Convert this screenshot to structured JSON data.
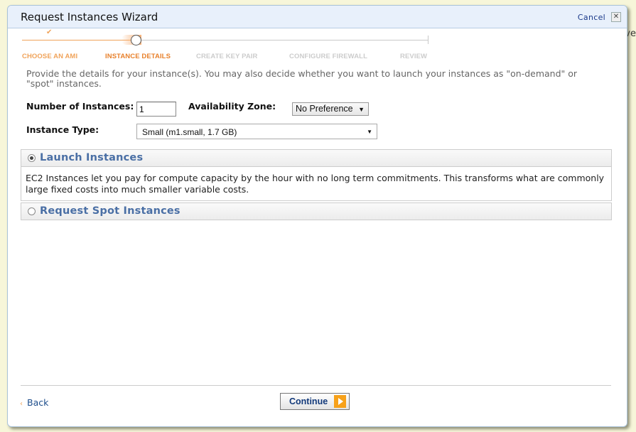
{
  "background_peek_text": "rve",
  "dialog": {
    "title": "Request Instances Wizard",
    "cancel_label": "Cancel",
    "close_glyph": "✕"
  },
  "wizard_steps": [
    {
      "label": "CHOOSE AN AMI",
      "state": "done"
    },
    {
      "label": "INSTANCE DETAILS",
      "state": "active"
    },
    {
      "label": "CREATE KEY PAIR",
      "state": "todo"
    },
    {
      "label": "CONFIGURE FIREWALL",
      "state": "todo"
    },
    {
      "label": "REVIEW",
      "state": "todo"
    }
  ],
  "check_glyph": "✔",
  "intro_text": "Provide the details for your instance(s). You may also decide whether you want to launch your instances as \"on-demand\" or \"spot\" instances.",
  "form": {
    "num_instances_label": "Number of Instances:",
    "num_instances_value": "1",
    "availability_zone_label": "Availability Zone:",
    "availability_zone_value": "No Preference",
    "availability_zone_arrow": "▼",
    "instance_type_label": "Instance Type:",
    "instance_type_value": "Small (m1.small, 1.7 GB)",
    "instance_type_arrow": "▼"
  },
  "options": {
    "launch": {
      "title": "Launch Instances",
      "selected": true,
      "description": "EC2 Instances let you pay for compute capacity by the hour with no long term commitments. This transforms what are commonly large fixed costs into much smaller variable costs."
    },
    "spot": {
      "title": "Request Spot Instances",
      "selected": false
    }
  },
  "footer": {
    "back_glyph": "‹",
    "back_label": "Back",
    "continue_label": "Continue"
  },
  "colors": {
    "accent_orange": "#f0a35a",
    "active_step": "#e8812c",
    "link_blue": "#1e4e8c",
    "panel_title": "#4a6fa5"
  }
}
